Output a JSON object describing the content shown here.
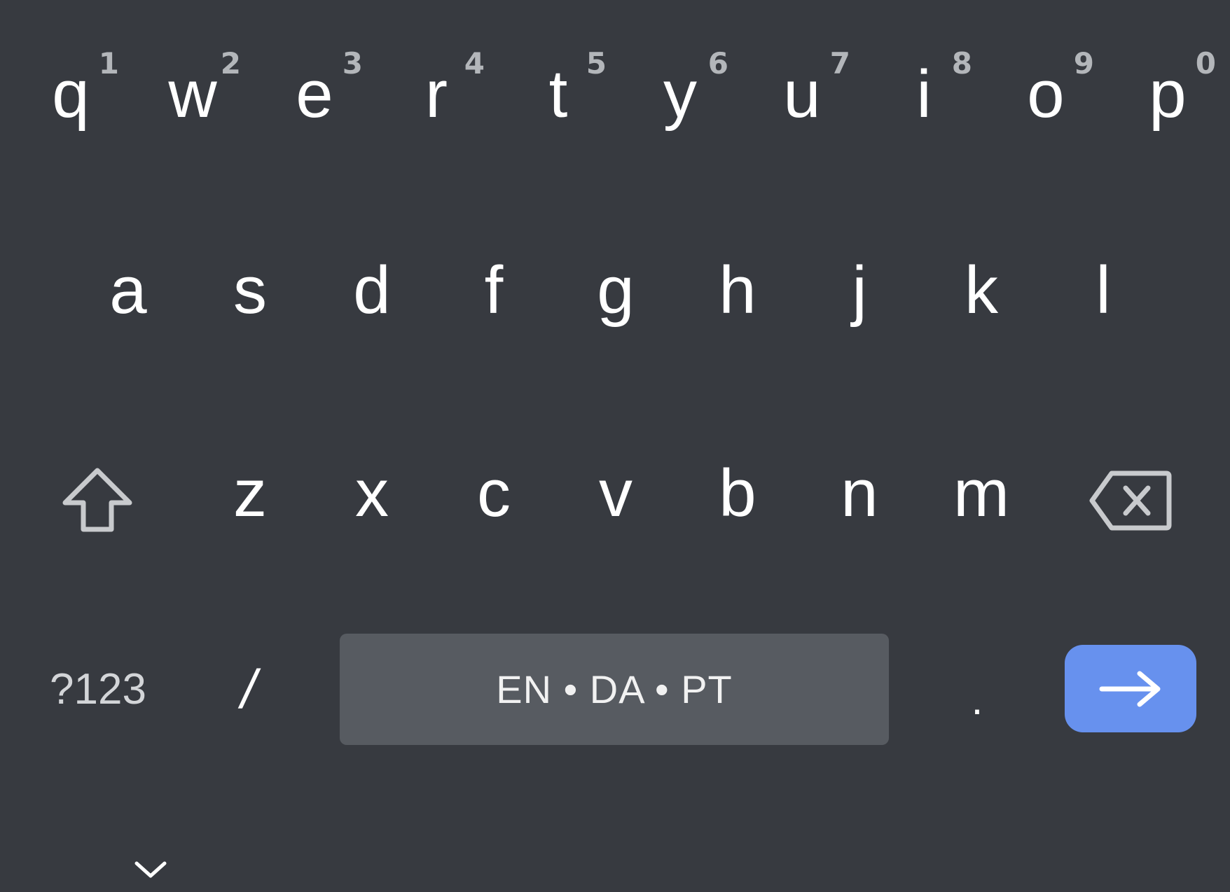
{
  "keyboard": {
    "row1": [
      {
        "letter": "q",
        "hint": "1"
      },
      {
        "letter": "w",
        "hint": "2"
      },
      {
        "letter": "e",
        "hint": "3"
      },
      {
        "letter": "r",
        "hint": "4"
      },
      {
        "letter": "t",
        "hint": "5"
      },
      {
        "letter": "y",
        "hint": "6"
      },
      {
        "letter": "u",
        "hint": "7"
      },
      {
        "letter": "i",
        "hint": "8"
      },
      {
        "letter": "o",
        "hint": "9"
      },
      {
        "letter": "p",
        "hint": "0"
      }
    ],
    "row2": [
      "a",
      "s",
      "d",
      "f",
      "g",
      "h",
      "j",
      "k",
      "l"
    ],
    "row3": [
      "z",
      "x",
      "c",
      "v",
      "b",
      "n",
      "m"
    ],
    "bottom": {
      "symbols_label": "?123",
      "slash_label": "/",
      "space_label": "EN • DA • PT",
      "period_label": "."
    },
    "icons": {
      "shift": "shift-icon",
      "backspace": "backspace-icon",
      "enter": "arrow-right-icon",
      "collapse": "chevron-down-icon"
    },
    "colors": {
      "background": "#373A40",
      "space_key": "#575B61",
      "enter_key": "#6791EE",
      "hint_text": "#B3B6BA"
    }
  }
}
